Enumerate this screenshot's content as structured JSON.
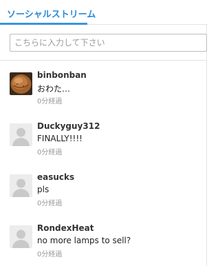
{
  "tab": {
    "label": "ソーシャルストリーム"
  },
  "search": {
    "placeholder": "こちらに入力して下さい"
  },
  "posts": [
    {
      "username": "binbonban",
      "message": "おわた…",
      "time": "0分経過",
      "avatar": "photo-avatar"
    },
    {
      "username": "Duckyguy312",
      "message": "FINALLY!!!!",
      "time": "0分経過",
      "avatar": "default-avatar"
    },
    {
      "username": "easucks",
      "message": "pls",
      "time": "0分経過",
      "avatar": "default-avatar"
    },
    {
      "username": "RondexHeat",
      "message": "no more lamps to sell?",
      "time": "0分経過",
      "avatar": "default-avatar"
    }
  ],
  "colors": {
    "accent": "#3d95d8",
    "tab_text": "#2b8ad6",
    "muted": "#9a9a9a"
  }
}
